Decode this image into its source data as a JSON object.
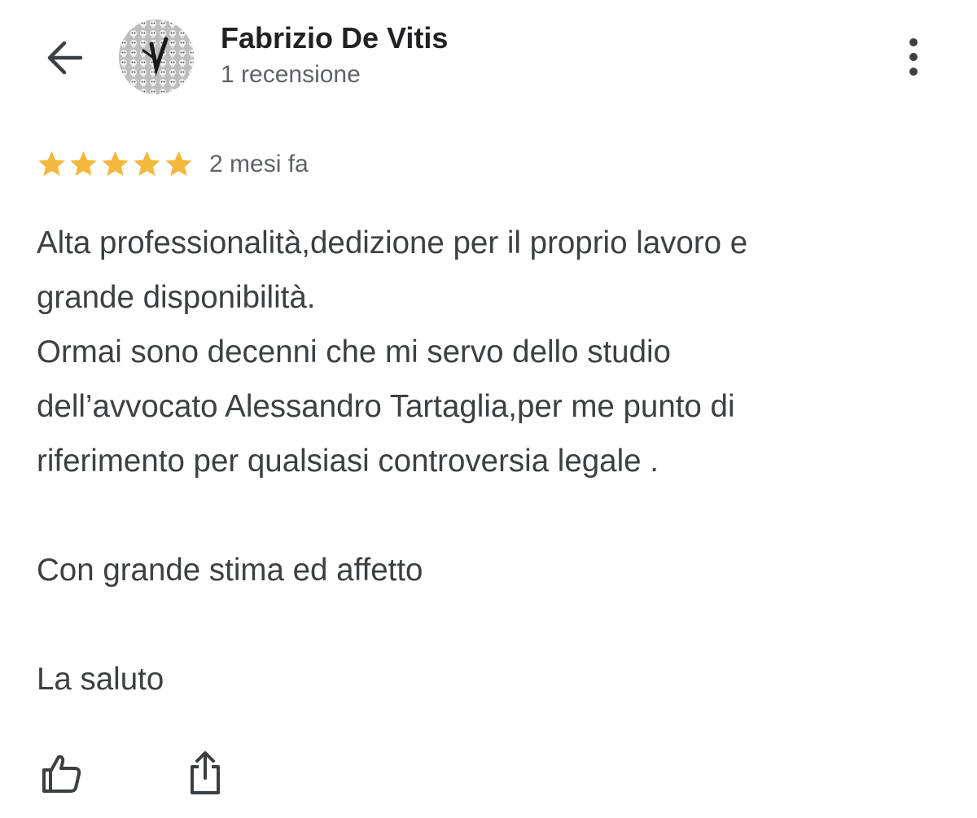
{
  "header": {
    "author_name": "Fabrizio De Vitis",
    "review_count": "1 recensione",
    "back_icon": "arrow-left-icon",
    "more_icon": "more-vert-icon"
  },
  "review": {
    "rating": 5,
    "rating_max": 5,
    "star_color": "#F4B83E",
    "date": "2 mesi fa",
    "lines": [
      "Alta professionalità,dedizione per il proprio lavoro e",
      "grande disponibilità.",
      "Ormai sono decenni che mi servo dello studio",
      "dell’avvocato Alessandro Tartaglia,per me punto di",
      "riferimento per qualsiasi controversia legale .",
      "",
      "Con grande stima ed affetto",
      "",
      "La saluto"
    ]
  },
  "actions": {
    "like_icon": "thumbs-up-icon",
    "share_icon": "share-icon"
  }
}
